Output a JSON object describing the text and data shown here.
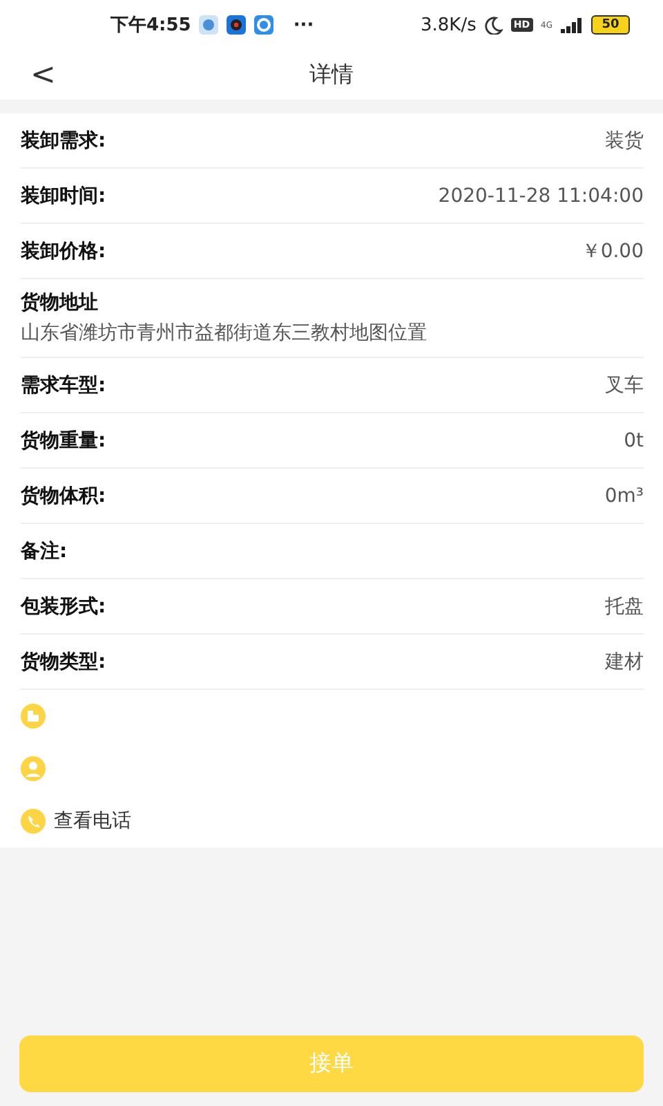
{
  "status_bar": {
    "time": "下午4:55",
    "more": "···",
    "speed": "3.8K/s",
    "hd": "HD",
    "network": "4G",
    "battery": "50"
  },
  "nav": {
    "back": "<",
    "title": "详情"
  },
  "rows": [
    {
      "kind": "pair",
      "label": "装卸需求:",
      "value": "装货"
    },
    {
      "kind": "pair",
      "label": "装卸时间:",
      "value": "2020-11-28 11:04:00"
    },
    {
      "kind": "pair",
      "label": "装卸价格:",
      "value": "￥0.00"
    },
    {
      "kind": "block",
      "label": "货物地址",
      "value": "山东省潍坊市青州市益都街道东三教村地图位置"
    },
    {
      "kind": "pair",
      "label": "需求车型:",
      "value": "叉车"
    },
    {
      "kind": "pair",
      "label": "货物重量:",
      "value": "0t"
    },
    {
      "kind": "pair",
      "label": "货物体积:",
      "value": "0m³"
    },
    {
      "kind": "pair",
      "label": "备注:"
    },
    {
      "kind": "pair",
      "label": "包装形式:",
      "value": "托盘"
    },
    {
      "kind": "pair",
      "label": "货物类型:",
      "value": "建材"
    }
  ],
  "contacts": [
    {
      "kind": "company"
    },
    {
      "kind": "contact"
    },
    {
      "kind": "call",
      "text": "查看电话"
    }
  ],
  "button": "接单"
}
